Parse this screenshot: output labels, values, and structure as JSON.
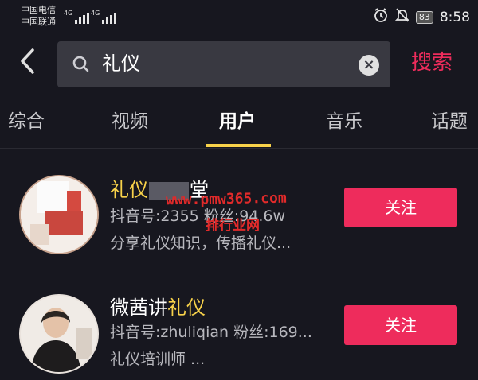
{
  "status_bar": {
    "carrier_1": "中国电信",
    "carrier_2": "中国联通",
    "network_1": "4G",
    "network_2": "4G",
    "battery": "83",
    "time": "8:58"
  },
  "search": {
    "query": "礼仪",
    "submit_label": "搜索"
  },
  "tabs": [
    {
      "label": "综合",
      "active": false
    },
    {
      "label": "视频",
      "active": false
    },
    {
      "label": "用户",
      "active": true
    },
    {
      "label": "音乐",
      "active": false
    },
    {
      "label": "话题",
      "active": false
    }
  ],
  "users": [
    {
      "name_highlight": "礼仪",
      "name_rest": "堂",
      "stats": "抖音号:2355 粉丝:94.6w",
      "bio": "分享礼仪知识，传播礼仪...",
      "follow_label": "关注"
    },
    {
      "name_prefix": "微茜讲",
      "name_highlight": "礼仪",
      "stats": "抖音号:zhuliqian 粉丝:169...",
      "bio": "礼仪培训师 ...",
      "follow_label": "关注"
    }
  ],
  "watermark": {
    "line1": "www.pmw365.com",
    "line2": "排行业网"
  },
  "colors": {
    "background": "#17171f",
    "accent_red": "#ee2c5c",
    "highlight_yellow": "#f8d24a",
    "search_bg": "#393941"
  }
}
